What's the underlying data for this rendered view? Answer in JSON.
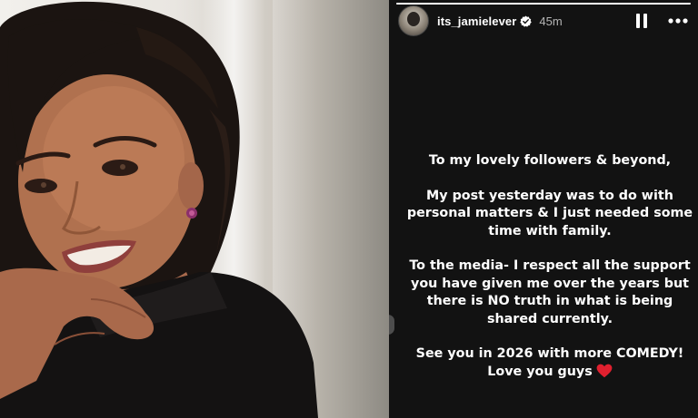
{
  "story": {
    "username": "its_jamielever",
    "timestamp": "45m",
    "progress_fraction": 1.0,
    "paragraphs": [
      "To my lovely followers & beyond,",
      "My post yesterday was to do with personal matters & I just needed some time with family.",
      "To the media- I respect all the support you have given me over the years but there is  NO truth in what is being shared currently.",
      "See you in 2026 with more COMEDY!"
    ],
    "closing_line": "Love you guys"
  },
  "icons": {
    "verified": "verified-badge-icon",
    "pause": "pause-icon",
    "more": "more-horizontal-icon",
    "heart": "red-heart-emoji"
  },
  "colors": {
    "story_background": "#121212",
    "text": "#ffffff",
    "timestamp": "#b5b5b5",
    "verified_badge": "#ffffff",
    "heart": "#e0202f"
  }
}
